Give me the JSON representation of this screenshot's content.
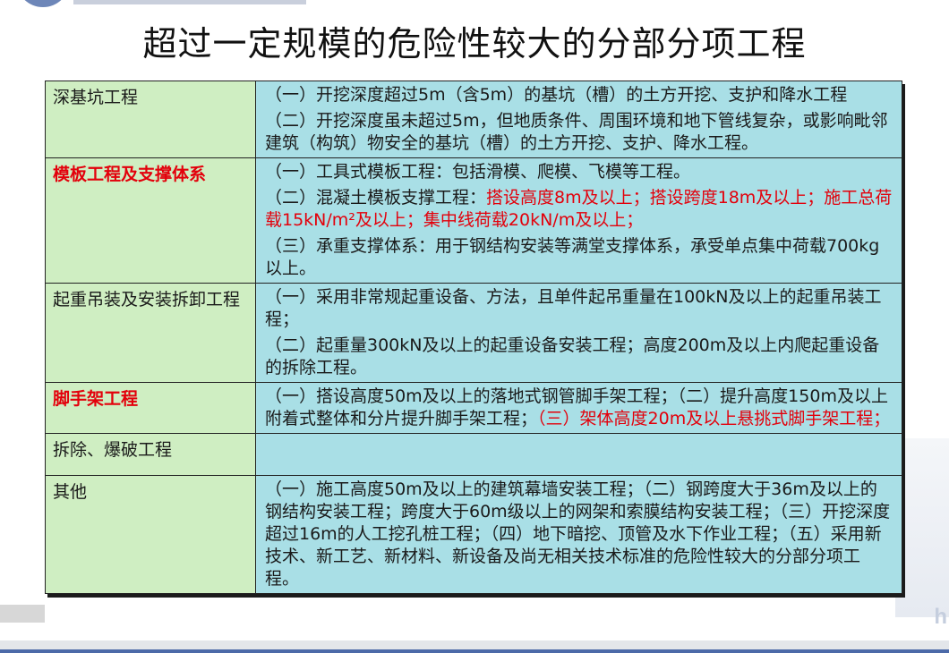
{
  "title": "超过一定规模的危险性较大的分部分项工程",
  "rows": [
    {
      "category": "深基坑工程",
      "category_red": false,
      "paras": [
        {
          "text": "（一）开挖深度超过5m（含5m）的基坑（槽）的土方开挖、支护和降水工程"
        },
        {
          "text": "（二）开挖深度虽未超过5m，但地质条件、周围环境和地下管线复杂，或影响毗邻建筑（构筑）物安全的基坑（槽）的土方开挖、支护、降水工程。"
        }
      ]
    },
    {
      "category": "模板工程及支撑体系",
      "category_red": true,
      "paras": [
        {
          "text": "（一）工具式模板工程：包括滑模、爬模、飞模等工程。"
        },
        {
          "text": "（二）混凝土模板支撑工程：",
          "red": "搭设高度8m及以上；搭设跨度18m及以上；施工总荷载15kN/m²及以上；集中线荷载20kN/m及以上；"
        },
        {
          "text": "（三）承重支撑体系：用于钢结构安装等满堂支撑体系，承受单点集中荷载700kg以上。"
        }
      ]
    },
    {
      "category": "起重吊装及安装拆卸工程",
      "category_red": false,
      "paras": [
        {
          "text": "（一）采用非常规起重设备、方法，且单件起吊重量在100kN及以上的起重吊装工程；"
        },
        {
          "text": "（二）起重量300kN及以上的起重设备安装工程；高度200m及以上内爬起重设备的拆除工程。"
        }
      ]
    },
    {
      "category": "脚手架工程",
      "category_red": true,
      "paras": [
        {
          "text": "（一）搭设高度50m及以上的落地式钢管脚手架工程；（二）提升高度150m及以上附着式整体和分片提升脚手架工程；",
          "red": "（三）架体高度20m及以上悬挑式脚手架工程；"
        }
      ]
    },
    {
      "category": "拆除、爆破工程",
      "category_red": false,
      "paras": []
    },
    {
      "category": "其他",
      "category_red": false,
      "paras": [
        {
          "text": "（一）施工高度50m及以上的建筑幕墙安装工程；（二）钢跨度大于36m及以上的钢结构安装工程；跨度大于60m级以上的网架和索膜结构安装工程；（三）开挖深度超过16m的人工挖孔桩工程；（四）地下暗挖、顶管及水下作业工程；（五）采用新技术、新工艺、新材料、新设备及尚无相关技术标准的危险性较大的分部分项工程。"
        }
      ]
    }
  ],
  "colors": {
    "category_bg": "#cfeec2",
    "desc_bg": "#a9dfe6",
    "highlight_red": "#e3000b"
  },
  "watermark": "h"
}
